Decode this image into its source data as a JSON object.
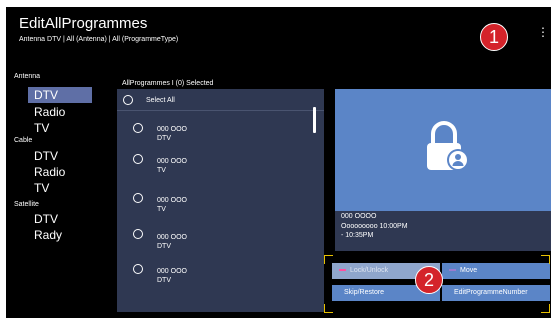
{
  "header": {
    "title": "EditAllProgrammes",
    "subtitle": "Antenna DTV | All (Antenna) | All (ProgrammeType)"
  },
  "sidebar": {
    "groups": [
      {
        "label": "Antenna",
        "items": [
          "DTV",
          "Radio",
          "TV"
        ]
      },
      {
        "label": "Cable",
        "items": [
          "DTV",
          "Radio",
          "TV"
        ]
      },
      {
        "label": "Satellite",
        "items": [
          "DTV",
          "Rady"
        ]
      }
    ]
  },
  "list": {
    "header": "AllProgrammes I (0) Selected",
    "select_all": "Select All",
    "items": [
      {
        "number": "000 OOO",
        "type": "DTV"
      },
      {
        "number": "000 OOO",
        "type": "TV"
      },
      {
        "number": "000 OOO",
        "type": "TV"
      },
      {
        "number": "000 OOO",
        "type": "DTV"
      },
      {
        "number": "000 OOO",
        "type": "DTV"
      }
    ]
  },
  "info": {
    "line1": "000 OOOO",
    "line2": "Ooooooooo 10:00PM",
    "line3": "- 10:35PM"
  },
  "actions": {
    "lock_unlock": "Lock/Unlock",
    "move": "Move",
    "skip_restore": "Skip/Restore",
    "edit_number": "EditProgrammeNumber"
  },
  "badges": {
    "one": "1",
    "two": "2"
  },
  "icons": {
    "menu": "more-vert-icon",
    "preview": "lock-user-icon"
  },
  "colors": {
    "background": "#000000",
    "panel": "#2f3852",
    "accent_blue": "#5b85c7",
    "selected_nav": "#5f6fa6",
    "highlight": "#e8c100",
    "badge": "#d4232a",
    "pink_key": "#ff4fa0",
    "purple_key": "#9a7bd0"
  }
}
